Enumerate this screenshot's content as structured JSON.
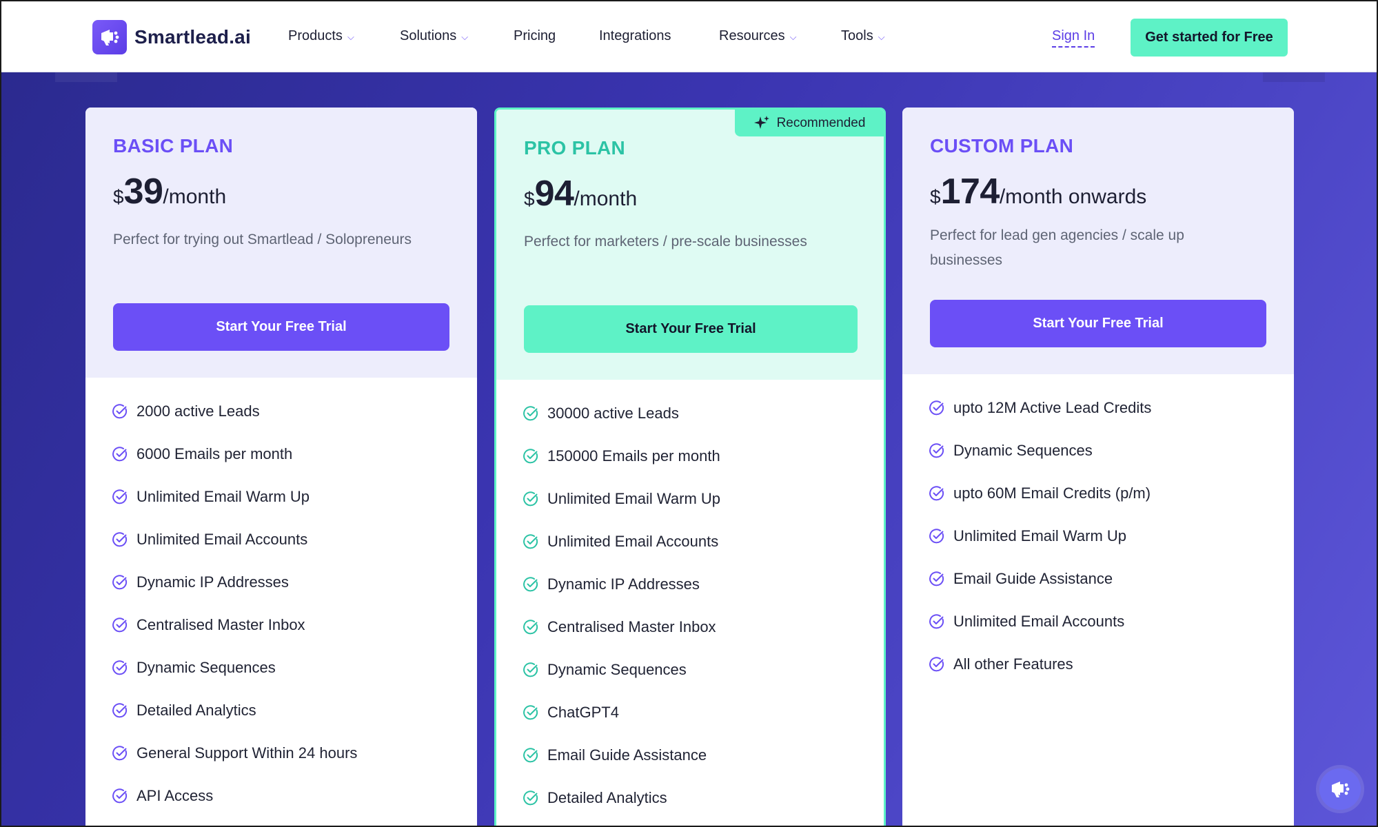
{
  "brand": {
    "name": "Smartlead.ai",
    "accent": "#6b4ff6",
    "mint": "#5ef2c6"
  },
  "nav": {
    "items": [
      {
        "label": "Products",
        "has_dropdown": true
      },
      {
        "label": "Solutions",
        "has_dropdown": true
      },
      {
        "label": "Pricing",
        "has_dropdown": false
      },
      {
        "label": "Integrations",
        "has_dropdown": false
      },
      {
        "label": "Resources",
        "has_dropdown": true
      },
      {
        "label": "Tools",
        "has_dropdown": true
      }
    ],
    "sign_in": "Sign In",
    "cta": "Get started for Free"
  },
  "plans": {
    "basic": {
      "title": "BASIC PLAN",
      "currency": "$",
      "amount": "39",
      "period": "/month",
      "description": "Perfect for trying out Smartlead / Solopreneurs",
      "button": "Start Your Free Trial",
      "features": [
        "2000 active Leads",
        "6000 Emails per month",
        "Unlimited Email Warm Up",
        "Unlimited Email Accounts",
        "Dynamic IP Addresses",
        "Centralised Master Inbox",
        "Dynamic Sequences",
        "Detailed Analytics",
        "General Support Within 24 hours",
        "API Access"
      ]
    },
    "pro": {
      "badge": "Recommended",
      "title": "PRO PLAN",
      "currency": "$",
      "amount": "94",
      "period": "/month",
      "description": "Perfect for marketers / pre-scale businesses",
      "button": "Start Your Free Trial",
      "features": [
        "30000 active Leads",
        "150000 Emails per month",
        "Unlimited Email Warm Up",
        "Unlimited Email Accounts",
        "Dynamic IP Addresses",
        "Centralised Master Inbox",
        "Dynamic Sequences",
        "ChatGPT4",
        "Email Guide Assistance",
        "Detailed Analytics"
      ]
    },
    "custom": {
      "title": "CUSTOM PLAN",
      "currency": "$",
      "amount": "174",
      "period": "/month onwards",
      "description": "Perfect for lead gen agencies / scale up businesses",
      "button": "Start Your Free Trial",
      "features": [
        "upto 12M Active Lead Credits",
        "Dynamic Sequences",
        "upto 60M Email Credits (p/m)",
        "Unlimited Email Warm Up",
        "Email Guide Assistance",
        "Unlimited Email Accounts",
        "All other Features"
      ]
    }
  },
  "icons": {
    "logo": "megaphone-icon",
    "dropdown": "chevron-down-icon",
    "feature": "check-circle-icon",
    "badge": "sparkle-icon",
    "chat": "megaphone-chat-icon"
  }
}
